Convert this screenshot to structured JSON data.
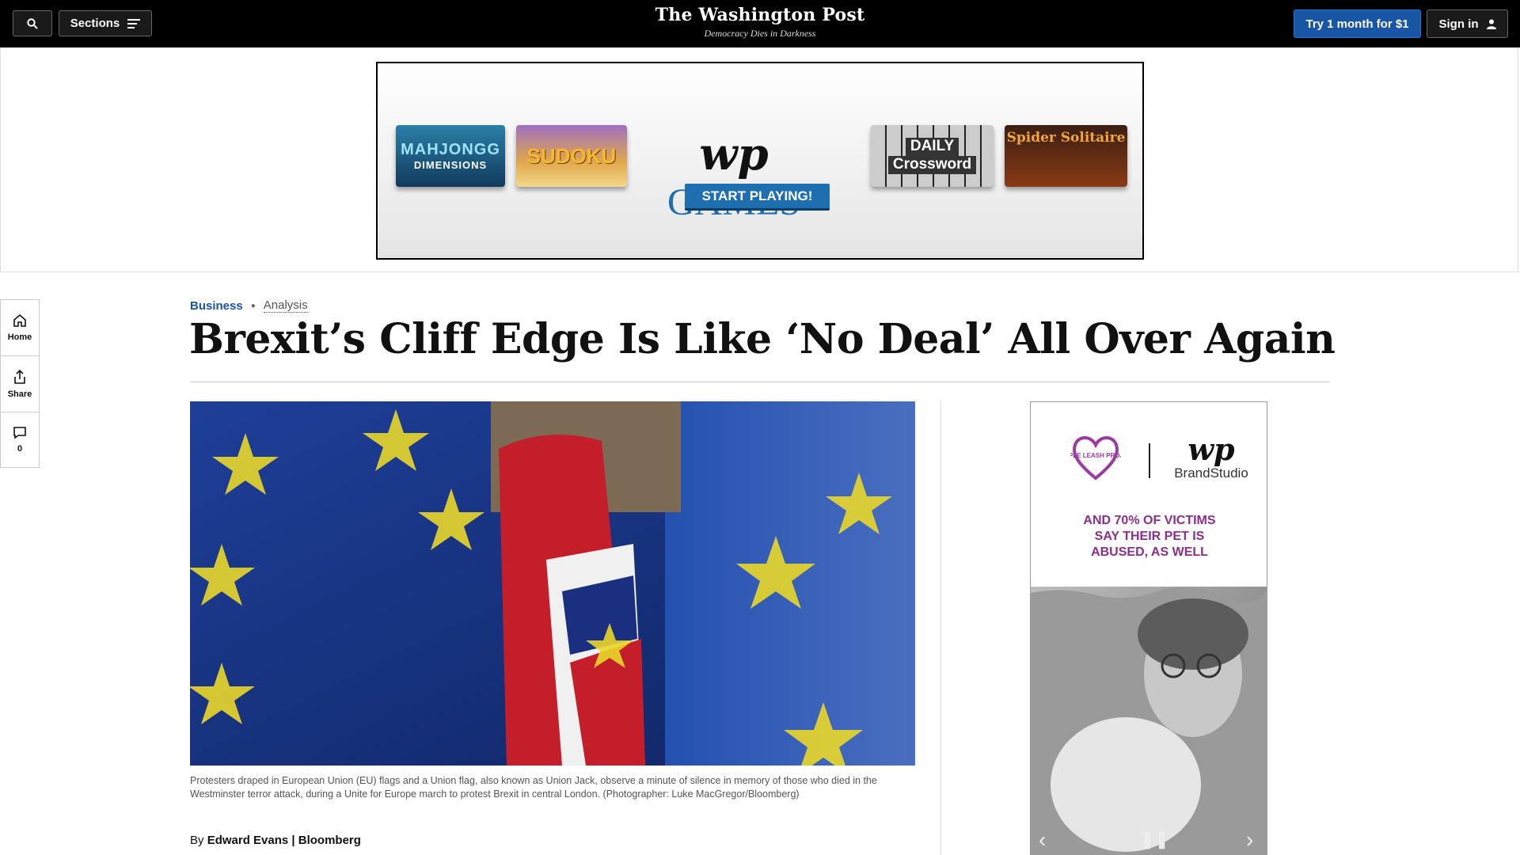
{
  "header": {
    "sections_label": "Sections",
    "logo": "The Washington Post",
    "tagline": "Democracy Dies in Darkness",
    "try_label": "Try 1 month for $1",
    "signin_label": "Sign in"
  },
  "banner_ad": {
    "tile_mahjong": "MAHJONGG",
    "tile_mahjong_sub": "DIMENSIONS",
    "tile_sudoku": "SUDOKU",
    "logo_wp": "wp",
    "logo_games": "GAMES",
    "cta": "START PLAYING!",
    "tile_crossword_1": "DAILY",
    "tile_crossword_2": "Crossword",
    "tile_spider": "Spider Solitaire"
  },
  "rail": {
    "home": "Home",
    "share": "Share",
    "comments_count": "0"
  },
  "article": {
    "section": "Business",
    "label": "Analysis",
    "headline": "Brexit’s Cliff Edge Is Like ‘No Deal’ All Over Again",
    "caption": "Protesters draped in European Union (EU) flags and a Union flag, also known as Union Jack, observe a minute of silence in memory of those who died in the Westminster terror attack, during a Unite for Europe march to protest Brexit in central London. (Photographer: Luke MacGregor/Bloomberg)",
    "byline_prefix": "By",
    "byline_author": "Edward Evans | Bloomberg"
  },
  "side_ad": {
    "sponsor_text": "PURPLE LEASH PROJECT",
    "wp": "wp",
    "brandstudio": "BrandStudio",
    "stat_line1": "AND 70% OF VICTIMS",
    "stat_line2": "SAY THEIR PET IS",
    "stat_line3": "ABUSED, AS WELL"
  },
  "colors": {
    "accent_blue": "#1955a5",
    "header_bg": "#000000",
    "ad_purple": "#8a2f8a"
  }
}
